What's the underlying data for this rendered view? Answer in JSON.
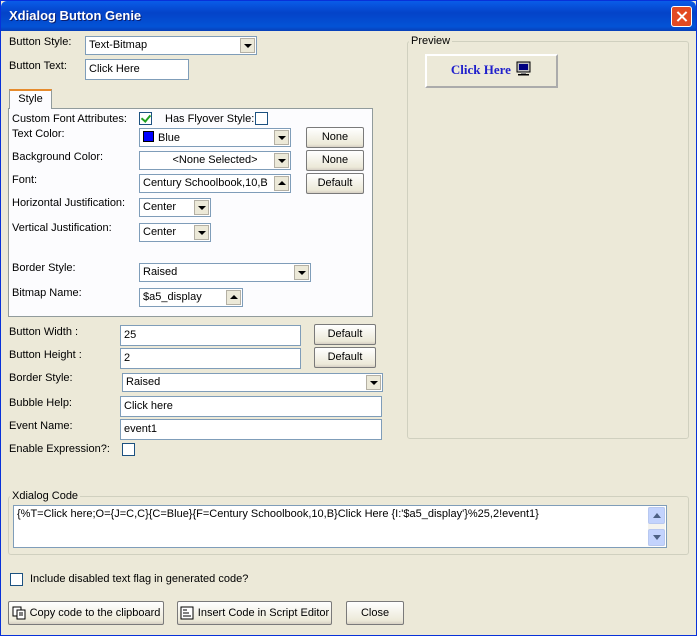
{
  "window": {
    "title": "Xdialog Button Genie"
  },
  "main": {
    "button_style_label": "Button Style:",
    "button_style_value": "Text-Bitmap",
    "button_text_label": "Button Text:",
    "button_text_value": "Click Here"
  },
  "style_tab": {
    "tab_label": "Style",
    "custom_font_label": "Custom Font Attributes:",
    "custom_font_checked": true,
    "flyover_label": "Has Flyover Style:",
    "flyover_checked": false,
    "text_color_label": "Text Color:",
    "text_color_value": "Blue",
    "text_color_swatch": "#0000FF",
    "none_label": "None",
    "bg_color_label": "Background Color:",
    "bg_color_value": "<None Selected>",
    "font_label": "Font:",
    "font_value": "Century Schoolbook,10,B",
    "default_label": "Default",
    "h_just_label": "Horizontal Justification:",
    "h_just_value": "Center",
    "v_just_label": "Vertical Justification:",
    "v_just_value": "Center",
    "border_style_label": "Border Style:",
    "border_style_value": "Raised",
    "bitmap_label": "Bitmap Name:",
    "bitmap_value": "$a5_display"
  },
  "lower": {
    "width_label": "Button Width :",
    "width_value": "25",
    "height_label": "Button Height :",
    "height_value": "2",
    "default_label": "Default",
    "border_style_label": "Border Style:",
    "border_style_value": "Raised",
    "bubble_label": "Bubble Help:",
    "bubble_value": "Click here",
    "event_label": "Event Name:",
    "event_value": "event1",
    "enable_expr_label": "Enable Expression?:"
  },
  "preview": {
    "group_label": "Preview",
    "button_text": "Click Here"
  },
  "code": {
    "group_label": "Xdialog Code",
    "value": "{%T=Click here;O={J=C,C}{C=Blue}{F=Century Schoolbook,10,B}Click Here {I:'$a5_display'}%25,2!event1}"
  },
  "footer": {
    "include_disabled_label": "Include disabled text flag in generated code?",
    "copy_label": "Copy code to the clipboard",
    "insert_label": "Insert Code in Script Editor",
    "close_label": "Close"
  }
}
